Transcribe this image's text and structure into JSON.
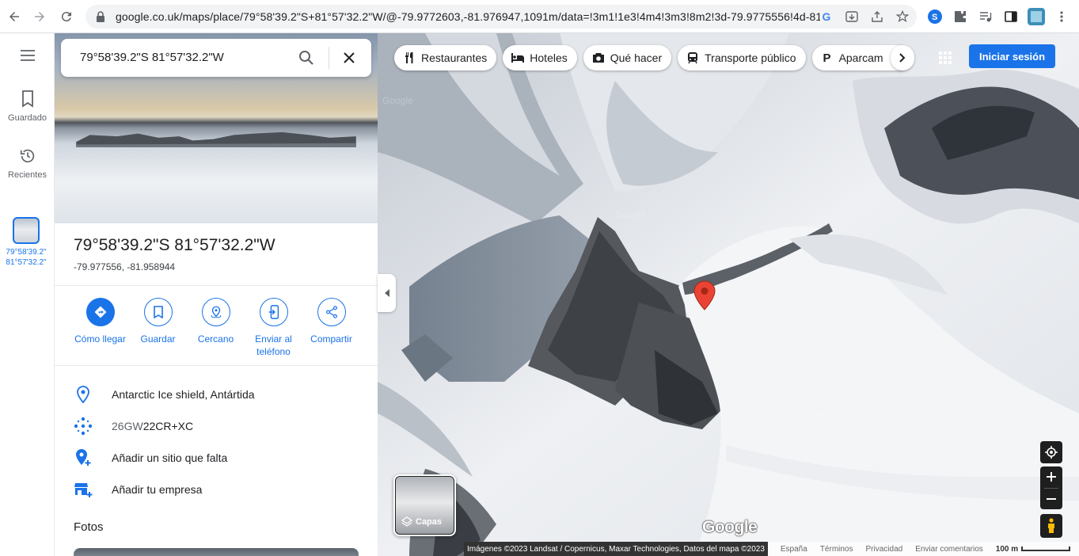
{
  "browser": {
    "url": "google.co.uk/maps/place/79°58'39.2\"S+81°57'32.2\"W/@-79.9772603,-81.976947,1091m/data=!3m1!1e3!4m4!3m3!8m2!3d-79.9775556!4d-81..."
  },
  "rail": {
    "saved_label": "Guardado",
    "recent_label": "Recientes",
    "recent_item_line1": "79°58'39.2\"",
    "recent_item_line2": "81°57'32.2\""
  },
  "search": {
    "query": "79°58'39.2\"S 81°57'32.2\"W"
  },
  "place": {
    "title": "79°58'39.2\"S 81°57'32.2\"W",
    "coords": "-79.977556, -81.958944"
  },
  "actions": [
    {
      "label": "Cómo llegar",
      "icon": "directions-icon"
    },
    {
      "label": "Guardar",
      "icon": "bookmark-icon"
    },
    {
      "label": "Cercano",
      "icon": "nearby-icon"
    },
    {
      "label": "Enviar al teléfono",
      "icon": "send-to-phone-icon"
    },
    {
      "label": "Compartir",
      "icon": "share-icon"
    }
  ],
  "info": {
    "location": "Antarctic Ice shield, Antártida",
    "pluscode_prefix": "26GW",
    "pluscode_main": "22CR+XC",
    "add_place": "Añadir un sitio que falta",
    "add_business": "Añadir tu empresa"
  },
  "photos_heading": "Fotos",
  "chips": [
    {
      "label": "Restaurantes",
      "icon": "restaurant-icon"
    },
    {
      "label": "Hoteles",
      "icon": "hotel-icon"
    },
    {
      "label": "Qué hacer",
      "icon": "camera-icon"
    },
    {
      "label": "Transporte público",
      "icon": "transit-icon"
    },
    {
      "label": "Aparcam",
      "icon": "parking-icon"
    }
  ],
  "signin_label": "Iniciar sesión",
  "layers_label": "Capas",
  "google_logo": "Google",
  "footer": {
    "credit": "Imágenes ©2023 Landsat / Copernicus, Maxar Technologies, Datos del mapa ©2023",
    "country": "España",
    "terms": "Términos",
    "privacy": "Privacidad",
    "feedback": "Enviar comentarios",
    "scale": "100 m"
  },
  "colors": {
    "accent": "#1a73e8",
    "pin": "#ea4335"
  }
}
